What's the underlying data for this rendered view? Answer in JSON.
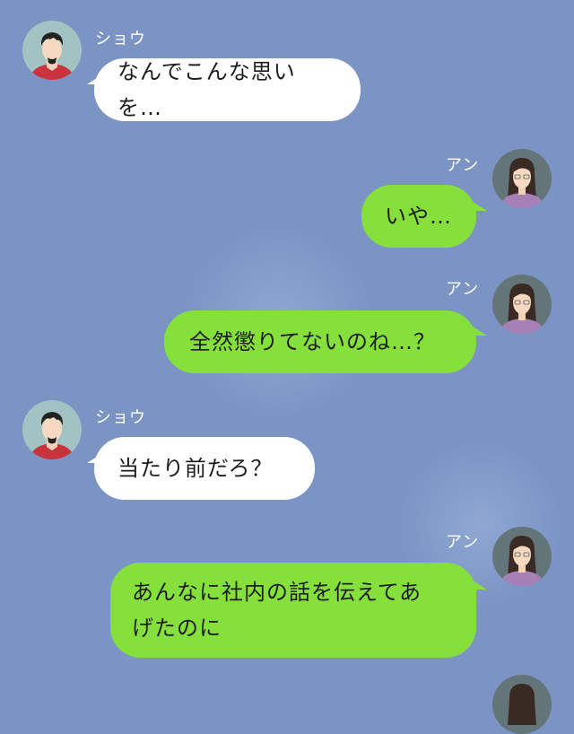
{
  "contacts": {
    "sho": {
      "name": "ショウ",
      "icon": "man-avatar-icon"
    },
    "an": {
      "name": "アン",
      "icon": "woman-avatar-icon"
    }
  },
  "messages": [
    {
      "sender": "ショウ",
      "side": "left",
      "text": "なんでこんな思いを…"
    },
    {
      "sender": "アン",
      "side": "right",
      "text": "いや…"
    },
    {
      "sender": "アン",
      "side": "right",
      "text": "全然懲りてないのね…？"
    },
    {
      "sender": "ショウ",
      "side": "left",
      "text": "当たり前だろ？"
    },
    {
      "sender": "アン",
      "side": "right",
      "text": "あんなに社内の話を伝えてあ\nげたのに"
    }
  ],
  "colors": {
    "background": "#7b94c4",
    "incoming_bubble": "#ffffff",
    "outgoing_bubble": "#85e03c"
  }
}
